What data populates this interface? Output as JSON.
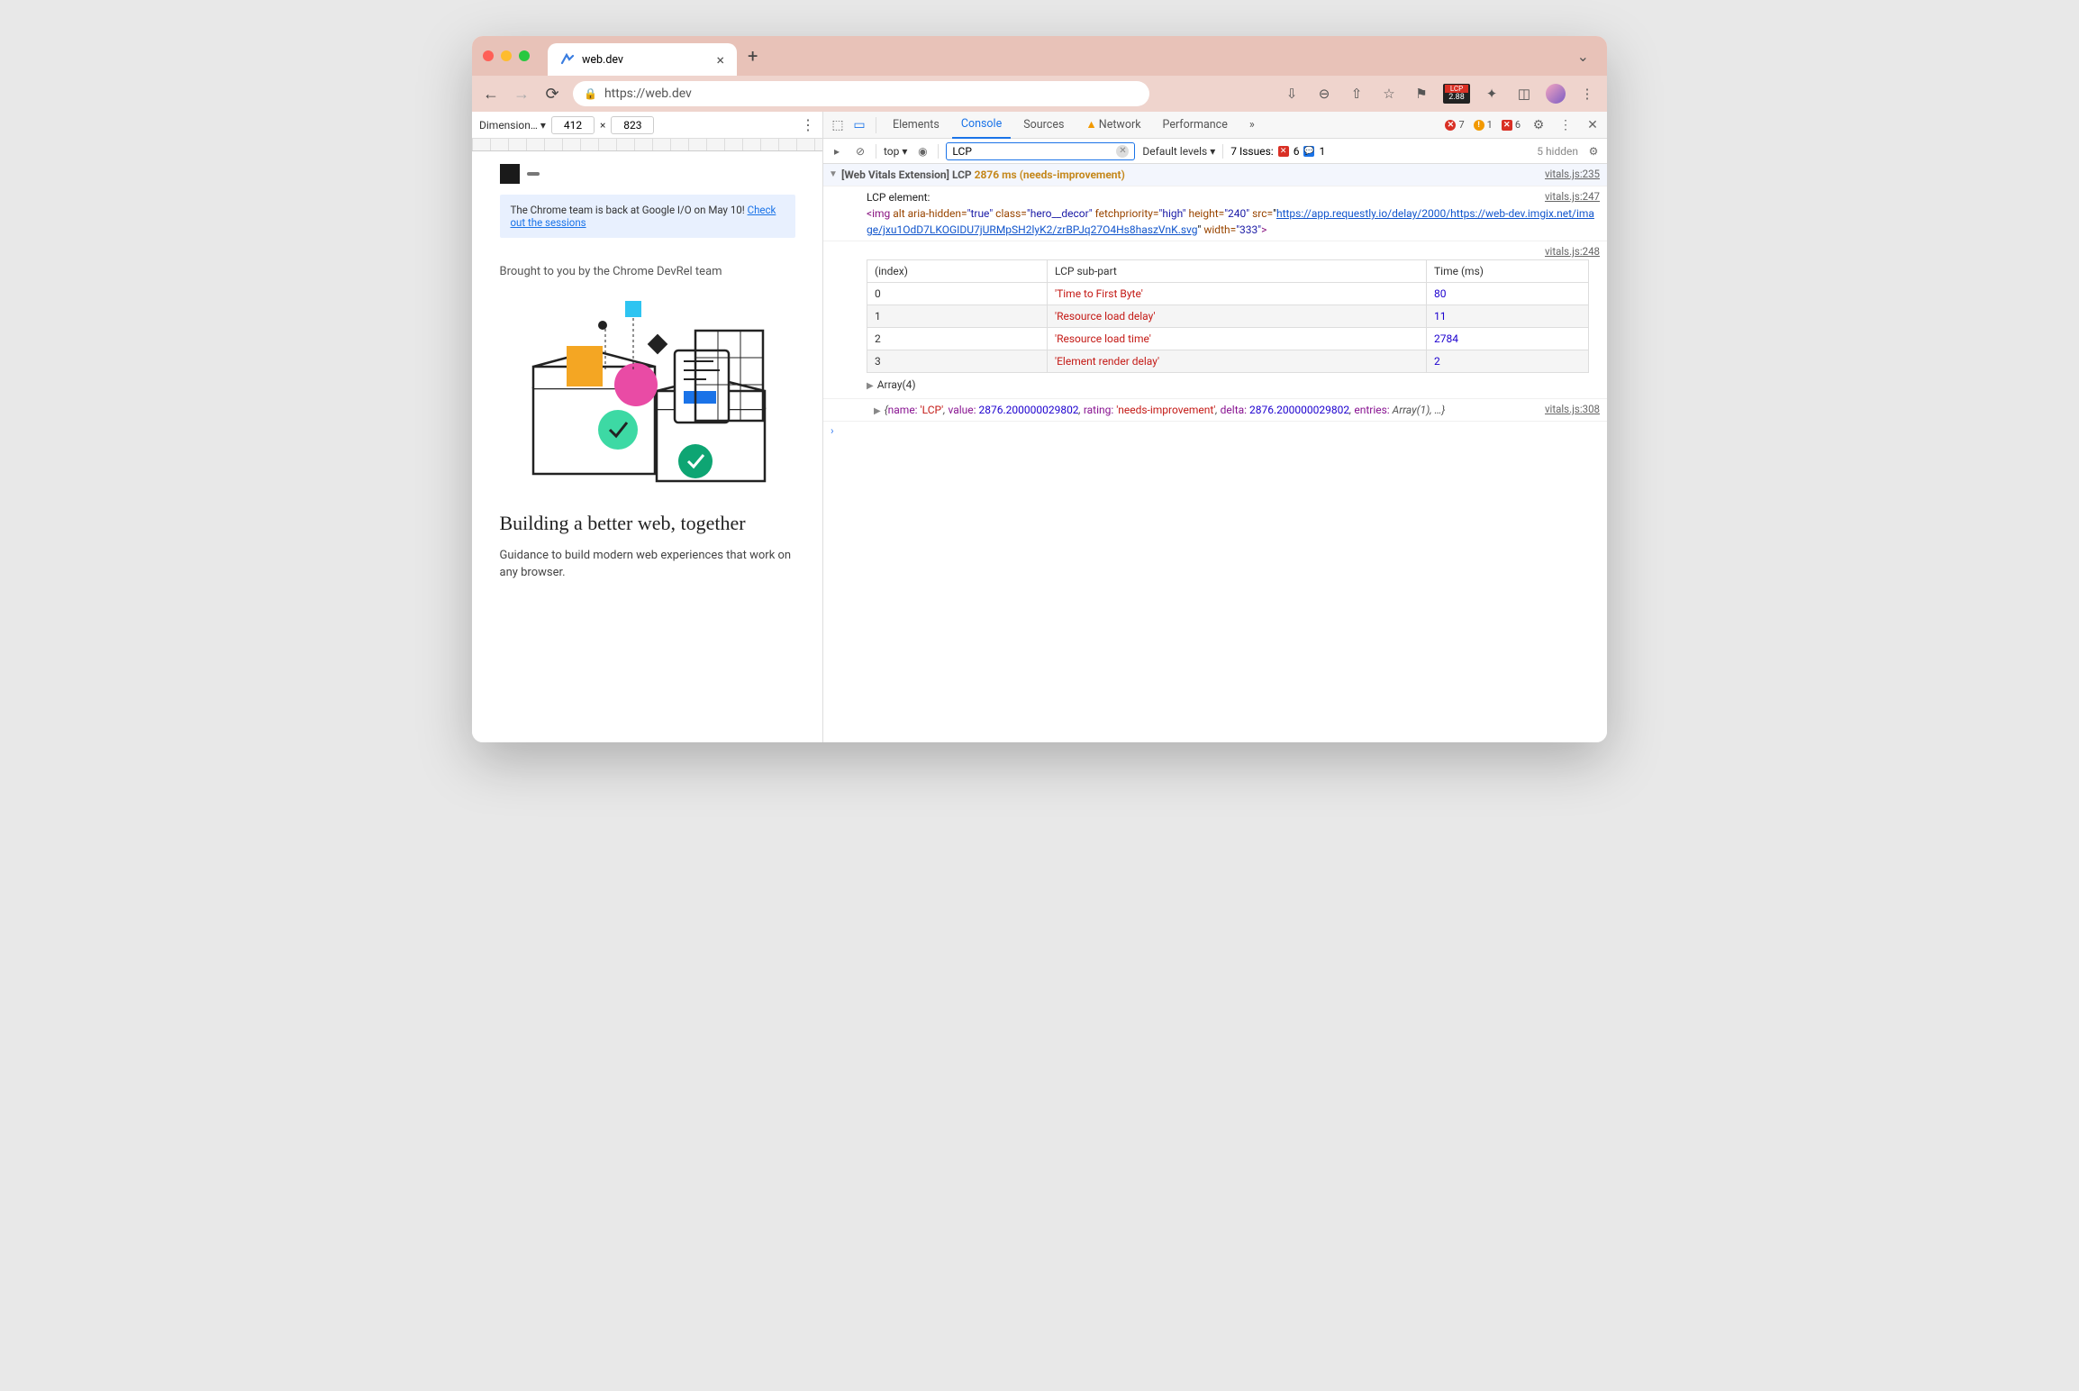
{
  "browser": {
    "tab_title": "web.dev",
    "url": "https://web.dev",
    "lcp_ext_badge": {
      "label": "LCP",
      "value": "2.88"
    }
  },
  "device_toolbar": {
    "label": "Dimension…",
    "width": "412",
    "height": "823",
    "sep": "×"
  },
  "page": {
    "io_banner_text": "The Chrome team is back at Google I/O on May 10! ",
    "io_banner_link": "Check out the sessions",
    "brought_by": "Brought to you by the Chrome DevRel team",
    "heading": "Building a better web, together",
    "paragraph": "Guidance to build modern web experiences that work on any browser."
  },
  "devtools": {
    "tabs": [
      "Elements",
      "Console",
      "Sources",
      "Network",
      "Performance"
    ],
    "active_tab": "Console",
    "more": "»",
    "errors": "7",
    "warnings": "1",
    "blocked": "6",
    "console_toolbar": {
      "context": "top",
      "filter_value": "LCP",
      "levels": "Default levels",
      "issues_label": "7 Issues:",
      "issues_err": "6",
      "issues_info": "1",
      "hidden": "5 hidden"
    }
  },
  "console_output": {
    "line1": {
      "prefix": "[Web Vitals Extension]",
      "metric": "LCP",
      "value": "2876 ms (needs-improvement)",
      "source": "vitals.js:235"
    },
    "line2": {
      "label": "LCP element:",
      "source": "vitals.js:247",
      "html_before_url": "<img alt aria-hidden=\"true\" class=\"hero__decor\" fetchpriority=\"high\" height=\"240\" src=\"",
      "url": "https://app.requestly.io/delay/2000/https://web-dev.imgix.net/image/jxu1OdD7LKOGIDU7jURMpSH2lyK2/zrBPJq27O4Hs8haszVnK.svg",
      "html_after_url": "\" width=\"333\">"
    },
    "table": {
      "source": "vitals.js:248",
      "headers": [
        "(index)",
        "LCP sub-part",
        "Time (ms)"
      ],
      "rows": [
        [
          "0",
          "'Time to First Byte'",
          "80"
        ],
        [
          "1",
          "'Resource load delay'",
          "11"
        ],
        [
          "2",
          "'Resource load time'",
          "2784"
        ],
        [
          "3",
          "'Element render delay'",
          "2"
        ]
      ],
      "array_label": "Array(4)"
    },
    "object": {
      "source": "vitals.js:308",
      "text_parts": {
        "name_k": "name:",
        "name_v": "'LCP'",
        "value_k": "value:",
        "value_v": "2876.200000029802",
        "rating_k": "rating:",
        "rating_v": "'needs-improvement'",
        "delta_k": "delta:",
        "delta_v": "2876.200000029802",
        "entries_k": "entries:",
        "entries_v": "Array(1)",
        "rest": ", …}"
      }
    }
  }
}
